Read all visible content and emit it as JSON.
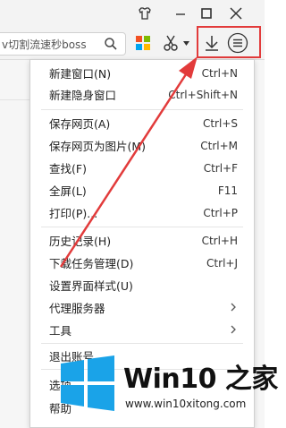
{
  "toolbar": {
    "address_text": "ⅴ切割流速秒boss"
  },
  "menu": {
    "groups": [
      [
        {
          "label": "新建窗口(N)",
          "shortcut": "Ctrl+N"
        },
        {
          "label": "新建隐身窗口",
          "shortcut": "Ctrl+Shift+N"
        }
      ],
      [
        {
          "label": "保存网页(A)",
          "shortcut": "Ctrl+S"
        },
        {
          "label": "保存网页为图片(M)",
          "shortcut": "Ctrl+M"
        },
        {
          "label": "查找(F)",
          "shortcut": "Ctrl+F"
        },
        {
          "label": "全屏(L)",
          "shortcut": "F11"
        },
        {
          "label": "打印(P)...",
          "shortcut": "Ctrl+P"
        }
      ],
      [
        {
          "label": "历史记录(H)",
          "shortcut": "Ctrl+H"
        },
        {
          "label": "下载任务管理(D)",
          "shortcut": "Ctrl+J"
        },
        {
          "label": "设置界面样式(U)",
          "shortcut": ""
        },
        {
          "label": "代理服务器",
          "shortcut": ""
        },
        {
          "label": "工具",
          "shortcut": ""
        }
      ],
      [
        {
          "label": "退出账号",
          "shortcut": ""
        }
      ],
      [
        {
          "label": "选项",
          "shortcut": ""
        },
        {
          "label": "帮助",
          "shortcut": ""
        }
      ]
    ]
  },
  "watermark": {
    "title": "Win10 之家",
    "url": "www.win10xitong.com"
  },
  "colors": {
    "highlight_red": "#e23b3b",
    "win_blue": "#1aa3e8"
  }
}
